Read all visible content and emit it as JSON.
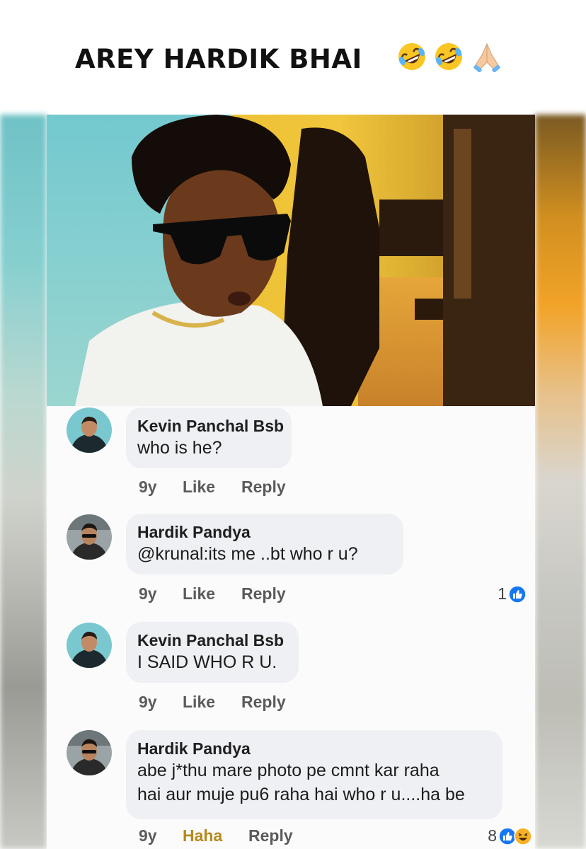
{
  "header": {
    "title": "AREY HARDIK BHAI",
    "emojis": [
      "rolling-on-floor-laughing",
      "rolling-on-floor-laughing",
      "folded-hands"
    ]
  },
  "comments": [
    {
      "author": "Kevin Panchal Bsb",
      "lines": [
        "who is he?"
      ],
      "time": "9y",
      "like_label": "Like",
      "reply_label": "Reply"
    },
    {
      "author": "Hardik Pandya",
      "lines": [
        "@krunal:its me ..bt who r u?"
      ],
      "time": "9y",
      "like_label": "Like",
      "reply_label": "Reply",
      "reaction_count": "1"
    },
    {
      "author": "Kevin Panchal Bsb",
      "lines": [
        "I SAID WHO R U."
      ],
      "time": "9y",
      "like_label": "Like",
      "reply_label": "Reply"
    },
    {
      "author": "Hardik Pandya",
      "lines": [
        "abe j*thu mare photo pe cmnt kar raha",
        "hai aur muje pu6 raha hai who r u....ha be"
      ],
      "time": "9y",
      "like_label": "Haha",
      "reply_label": "Reply",
      "reaction_count": "8"
    }
  ],
  "colors": {
    "like_blue": "#1877f2",
    "haha_yellow": "#f7b125",
    "haha_label": "#b58a1c",
    "bubble": "#eef0f3"
  }
}
